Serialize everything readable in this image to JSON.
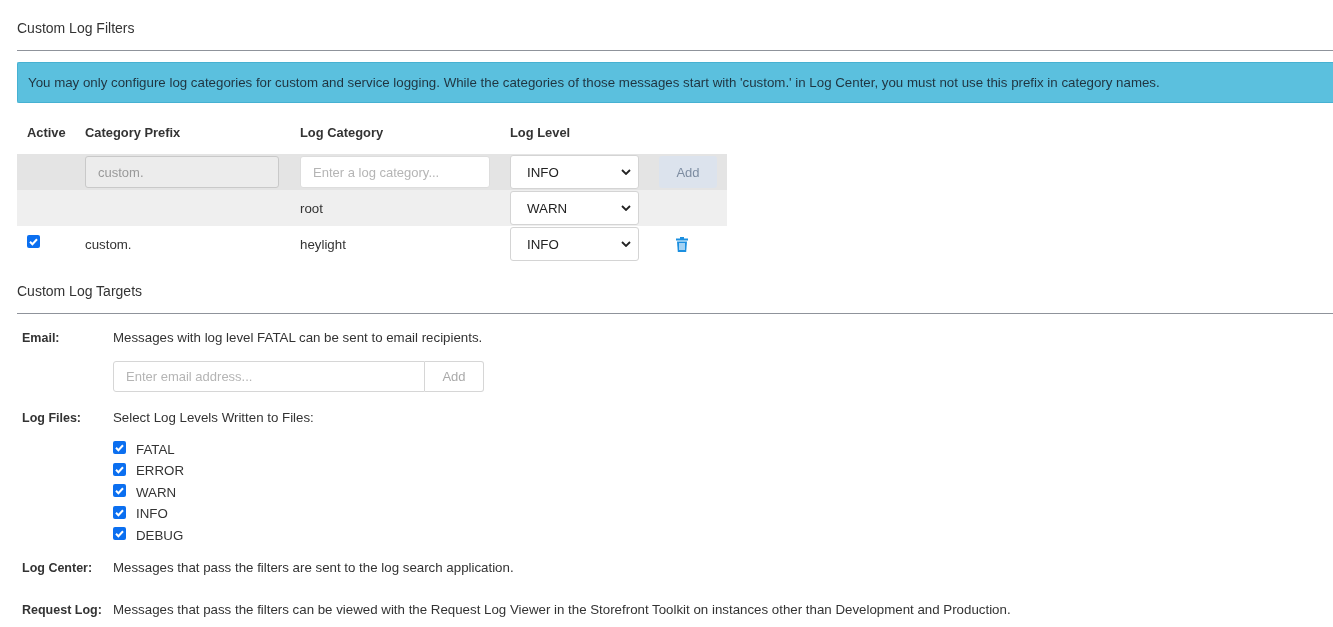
{
  "filters": {
    "title": "Custom Log Filters",
    "notice": "You may only configure log categories for custom and service logging. While the categories of those messages start with 'custom.' in Log Center, you must not use this prefix in category names.",
    "columns": [
      "Active",
      "Category Prefix",
      "Log Category",
      "Log Level"
    ],
    "new_row": {
      "prefix": {
        "value": "custom.",
        "disabled": true
      },
      "category": {
        "placeholder": "Enter a log category..."
      },
      "level": "INFO",
      "add_button": {
        "label": "Add",
        "disabled": true
      }
    },
    "rows": [
      {
        "kind": "root",
        "category": "root",
        "level": "WARN"
      },
      {
        "kind": "custom",
        "active": true,
        "prefix": "custom.",
        "category": "heylight",
        "level": "INFO"
      }
    ]
  },
  "targets": {
    "title": "Custom Log Targets",
    "items": [
      {
        "kind": "email",
        "label": "Email:",
        "text": "Messages with log level FATAL can be sent to email recipients.",
        "input": {
          "placeholder": "Enter email address..."
        },
        "add_button": {
          "label": "Add",
          "disabled": true
        }
      },
      {
        "kind": "levels",
        "label": "Log Files:",
        "text": "Select Log Levels Written to Files:",
        "levels": [
          {
            "label": "FATAL",
            "checked": true
          },
          {
            "label": "ERROR",
            "checked": true
          },
          {
            "label": "WARN",
            "checked": true
          },
          {
            "label": "INFO",
            "checked": true
          },
          {
            "label": "DEBUG",
            "checked": true
          }
        ]
      },
      {
        "kind": "text",
        "label": "Log Center:",
        "text": "Messages that pass the filters are sent to the log search application."
      },
      {
        "kind": "text",
        "label": "Request Log:",
        "text": "Messages that pass the filters can be viewed with the Request Log Viewer in the Storefront Toolkit on instances other than Development and Production."
      }
    ]
  }
}
